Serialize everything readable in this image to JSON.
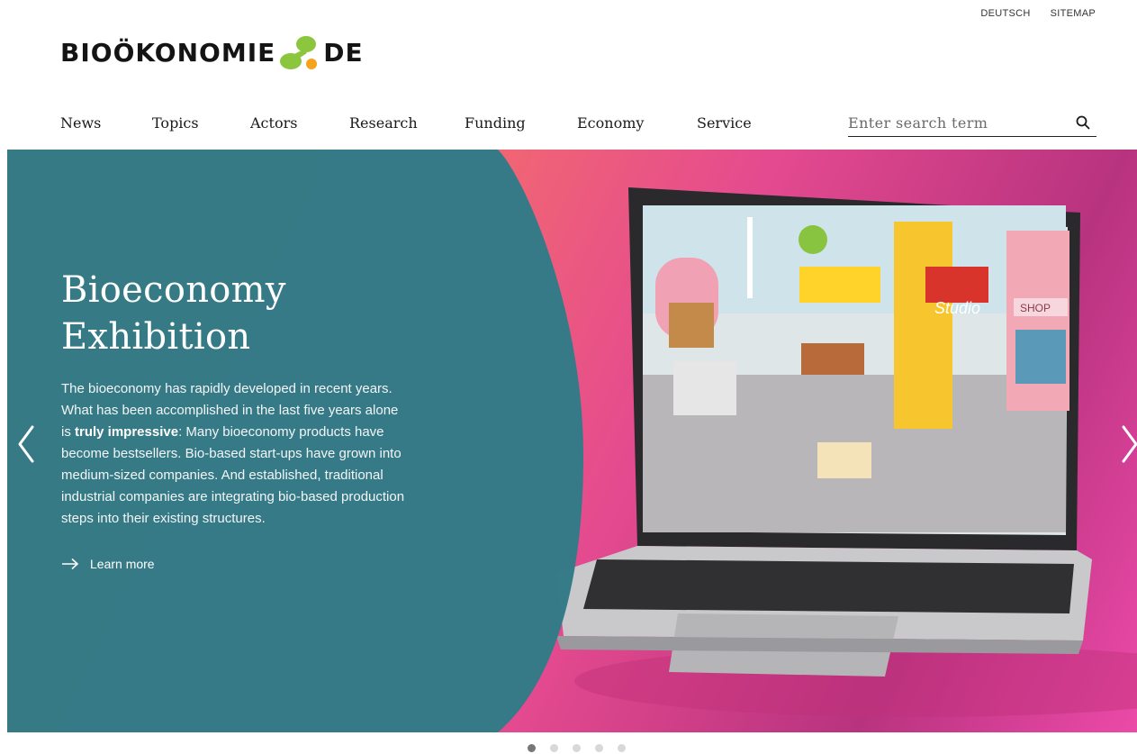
{
  "top_links": {
    "language": "DEUTSCH",
    "sitemap": "SITEMAP"
  },
  "logo": {
    "text_left": "BIOÖKONOMIE",
    "text_right": "DE"
  },
  "nav": {
    "items": [
      "News",
      "Topics",
      "Actors",
      "Research",
      "Funding",
      "Economy",
      "Service"
    ]
  },
  "search": {
    "placeholder": "Enter search term",
    "value": ""
  },
  "hero": {
    "title": "Bioeconomy Exhibition",
    "body_before": "The bioeconomy has rapidly developed in recent years. What has been accomplished in the last five years alone is ",
    "body_bold": "truly impressive",
    "body_after": ": Many bioeconomy products have become bestsellers. Bio-based start-ups have grown into medium-sized companies. And established, traditional industrial companies are integrating bio-based production steps into their existing structures.",
    "cta": "Learn more",
    "image_labels": {
      "studio": "Studio",
      "shop": "SHOP"
    }
  },
  "carousel": {
    "slides": 5,
    "active": 1
  },
  "colors": {
    "teal_panel": "#337a87",
    "logo_green": "#8cc63f",
    "logo_orange": "#f7a21b"
  }
}
